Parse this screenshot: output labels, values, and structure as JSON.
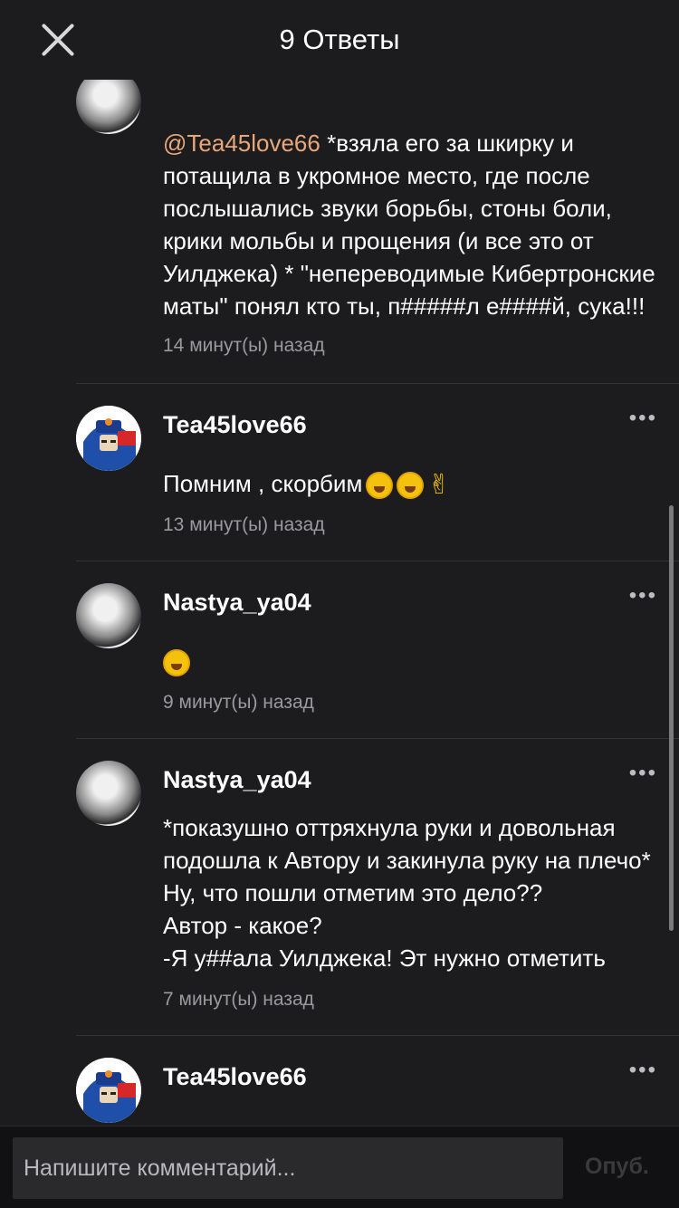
{
  "header": {
    "title": "9 Ответы"
  },
  "comments": [
    {
      "username": "",
      "mention": "@Tea45love66",
      "text": " *взяла его за шкирку и потащила в укромное место, где после послышались звуки борьбы, стоны боли, крики мольбы и прощения (и все это от Уилджека) * \"непереводимые Кибертронские маты\" понял кто ты, п#####л е####й, сука!!!",
      "time": "14 минут(ы) назад"
    },
    {
      "username": "Tea45love66",
      "text": "Помним , скорбим",
      "time": "13 минут(ы) назад"
    },
    {
      "username": "Nastya_ya04",
      "text": "",
      "time": "9 минут(ы) назад"
    },
    {
      "username": "Nastya_ya04",
      "text": "*показушно оттряхнула руки и довольная подошла к Автору и закинула руку на плечо* Ну, что пошли отметим это дело??\nАвтор - какое?\n-Я у##ала Уилджека! Эт нужно отметить",
      "time": "7 минут(ы) назад"
    },
    {
      "username": "Tea45love66",
      "text": "",
      "time": ""
    }
  ],
  "composer": {
    "placeholder": "Напишите комментарий...",
    "publish_label": "Опуб."
  },
  "icons": {
    "close": "close-icon",
    "more": "more-icon",
    "emoji_laugh": "rolling-on-floor-laughing-emoji",
    "emoji_victory": "victory-hand-emoji"
  }
}
